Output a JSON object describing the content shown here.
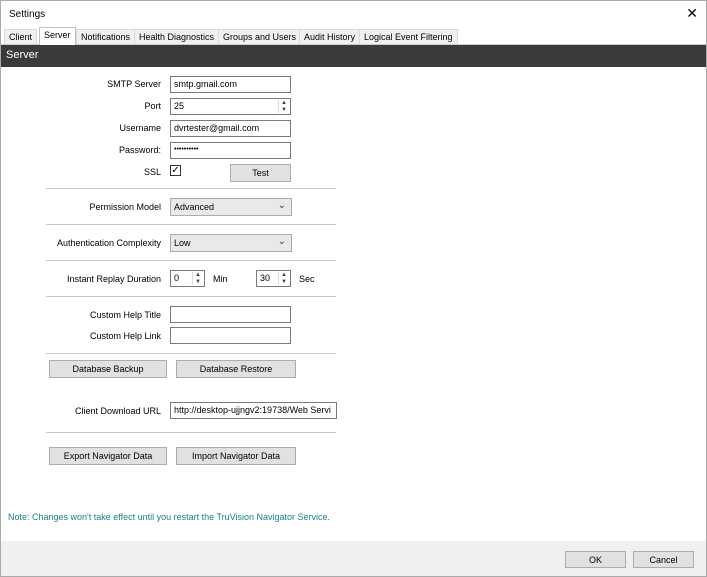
{
  "window": {
    "title": "Settings",
    "close_glyph": "✕"
  },
  "tabs": [
    {
      "label": "Client"
    },
    {
      "label": "Server"
    },
    {
      "label": "Notifications"
    },
    {
      "label": "Health Diagnostics"
    },
    {
      "label": "Groups and Users"
    },
    {
      "label": "Audit History"
    },
    {
      "label": "Logical Event Filtering"
    }
  ],
  "active_tab": "Server",
  "section": {
    "title": "Server"
  },
  "smtp": {
    "server_label": "SMTP Server",
    "server_value": "smtp.gmail.com",
    "port_label": "Port",
    "port_value": "25",
    "username_label": "Username",
    "username_value": "dvrtester@gmail.com",
    "password_label": "Password:",
    "password_value": "••••••••••",
    "ssl_label": "SSL",
    "ssl_checked": true,
    "ssl_check_glyph": "✓",
    "test_label": "Test"
  },
  "permission": {
    "label": "Permission Model",
    "value": "Advanced"
  },
  "auth": {
    "label": "Authentication Complexity",
    "value": "Low"
  },
  "replay": {
    "label": "Instant Replay Duration",
    "min_value": "0",
    "min_unit": "Min",
    "sec_value": "30",
    "sec_unit": "Sec"
  },
  "help": {
    "title_label": "Custom Help Title",
    "title_value": "",
    "link_label": "Custom Help Link",
    "link_value": ""
  },
  "database": {
    "backup_label": "Database Backup",
    "restore_label": "Database Restore"
  },
  "client_download": {
    "label": "Client Download URL",
    "value": "http://desktop-ujjngv2:19738/Web Servi"
  },
  "navigator": {
    "export_label": "Export Navigator Data",
    "import_label": "Import Navigator Data"
  },
  "note": "Note: Changes won't take effect until you restart the TruVision Navigator Service.",
  "footer": {
    "ok_label": "OK",
    "cancel_label": "Cancel"
  },
  "icons": {
    "spin_up": "▲",
    "spin_down": "▼",
    "dropdown": "⌄"
  },
  "colors": {
    "header_bg": "#3a3a3a",
    "note_text": "#1a7f8c"
  }
}
